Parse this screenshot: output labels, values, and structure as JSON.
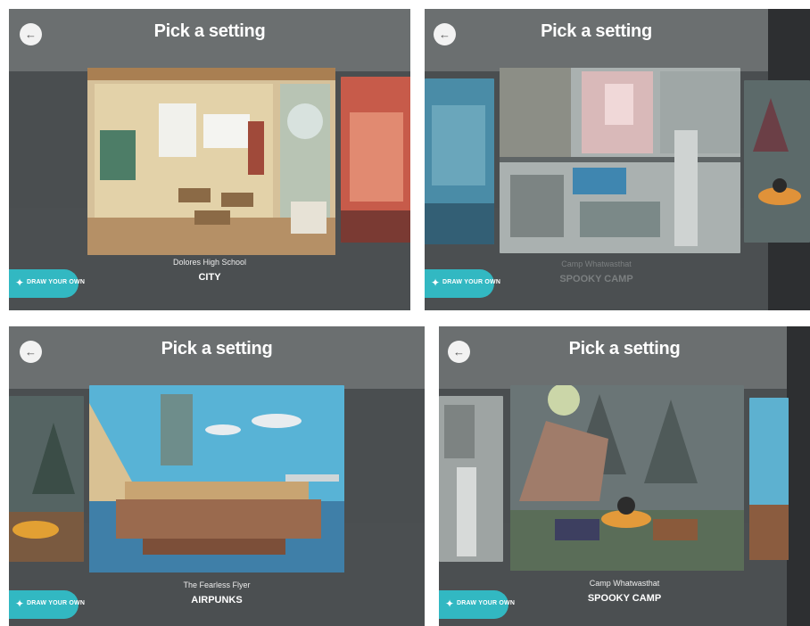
{
  "screen_title": "Pick a setting",
  "draw_button_label": "DRAW YOUR OWN",
  "panels": [
    {
      "setting_name": "Dolores High School",
      "genre": "CITY"
    },
    {
      "setting_name": "Camp Whatwasthat",
      "genre": "SPOOKY CAMP"
    },
    {
      "setting_name": "The Fearless Flyer",
      "genre": "AIRPUNKS"
    },
    {
      "setting_name": "Camp Whatwasthat",
      "genre": "SPOOKY CAMP"
    }
  ],
  "icons": {
    "back": "arrow-left-icon",
    "draw": "magic-wand-icon"
  },
  "colors": {
    "accent": "#32b8c2",
    "background": "#4a4e50",
    "text": "#ffffff"
  }
}
